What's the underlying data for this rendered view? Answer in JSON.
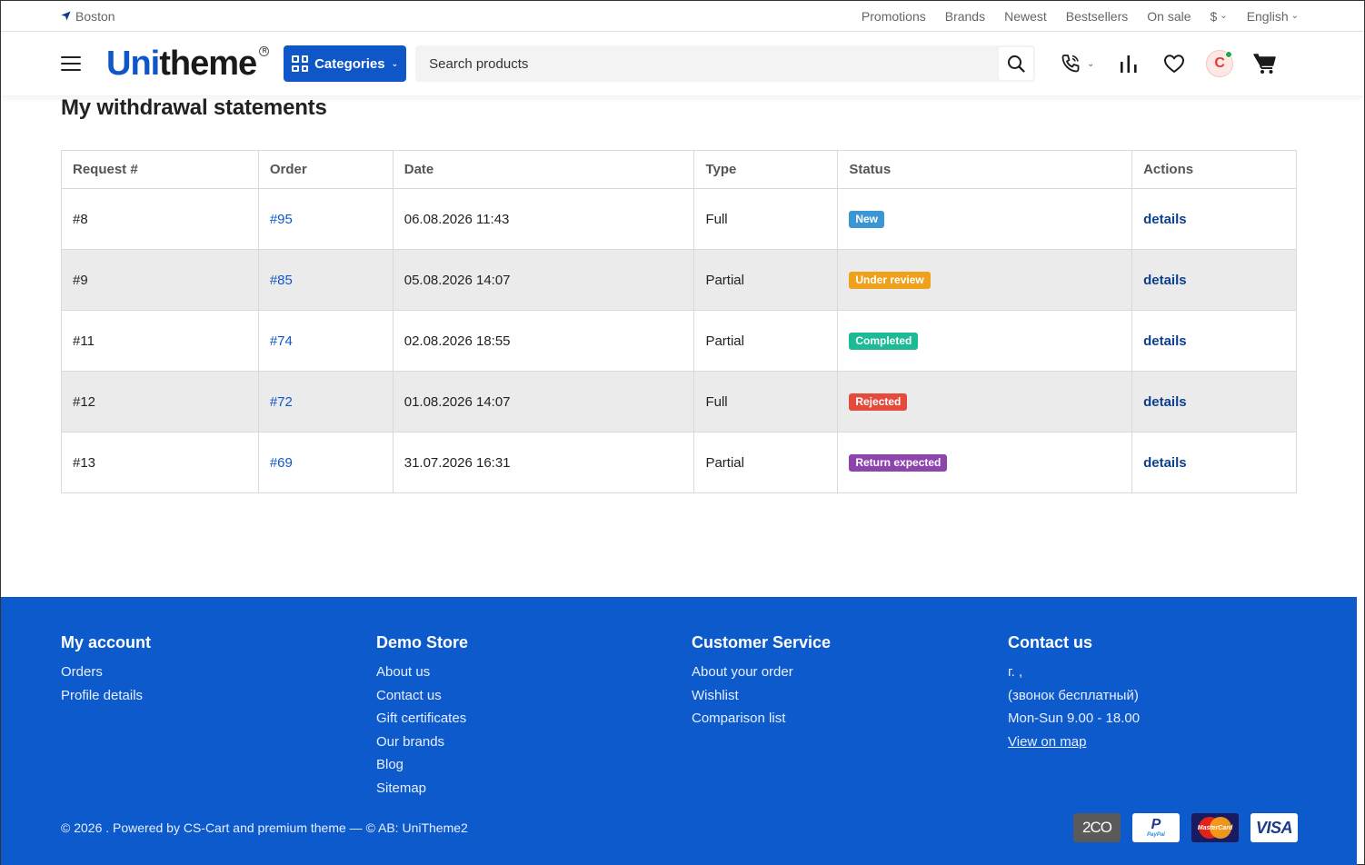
{
  "topbar": {
    "location": "Boston",
    "links": [
      "Promotions",
      "Brands",
      "Newest",
      "Bestsellers",
      "On sale"
    ],
    "currency": "$",
    "language": "English"
  },
  "header": {
    "logo_blue": "Uni",
    "logo_dark": "theme",
    "categories_label": "Categories",
    "search_placeholder": "Search products",
    "avatar_initial": "C"
  },
  "page": {
    "title": "My withdrawal statements"
  },
  "table": {
    "headers": [
      "Request #",
      "Order",
      "Date",
      "Type",
      "Status",
      "Actions"
    ],
    "rows": [
      {
        "request": "#8",
        "order": "#95",
        "date": "06.08.2026 11:43",
        "type": "Full",
        "status": "New",
        "status_color": "#3a97d4",
        "action": "details"
      },
      {
        "request": "#9",
        "order": "#85",
        "date": "05.08.2026 14:07",
        "type": "Partial",
        "status": "Under review",
        "status_color": "#f0a11c",
        "action": "details"
      },
      {
        "request": "#11",
        "order": "#74",
        "date": "02.08.2026 18:55",
        "type": "Partial",
        "status": "Completed",
        "status_color": "#1dbb95",
        "action": "details"
      },
      {
        "request": "#12",
        "order": "#72",
        "date": "01.08.2026 14:07",
        "type": "Full",
        "status": "Rejected",
        "status_color": "#e54b3d",
        "action": "details"
      },
      {
        "request": "#13",
        "order": "#69",
        "date": "31.07.2026 16:31",
        "type": "Partial",
        "status": "Return expected",
        "status_color": "#8e44ad",
        "action": "details"
      }
    ]
  },
  "footer": {
    "my_account": {
      "title": "My account",
      "links": [
        "Orders",
        "Profile details"
      ]
    },
    "demo_store": {
      "title": "Demo Store",
      "links": [
        "About us",
        "Contact us",
        "Gift certificates",
        "Our brands",
        "Blog",
        "Sitemap"
      ]
    },
    "customer_service": {
      "title": "Customer Service",
      "links": [
        "About your order",
        "Wishlist",
        "Comparison list"
      ]
    },
    "contact": {
      "title": "Contact us",
      "lines": [
        "г. ,",
        "(звонок бесплатный)",
        "Mon-Sun 9.00 - 18.00"
      ],
      "map_link": "View on map"
    },
    "copyright": "© 2026 . Powered by CS-Cart and premium theme — © AB: UniTheme2",
    "payments": {
      "tco": "2CO",
      "paypal": "PayPal",
      "mastercard": "MasterCard",
      "visa": "VISA"
    }
  }
}
